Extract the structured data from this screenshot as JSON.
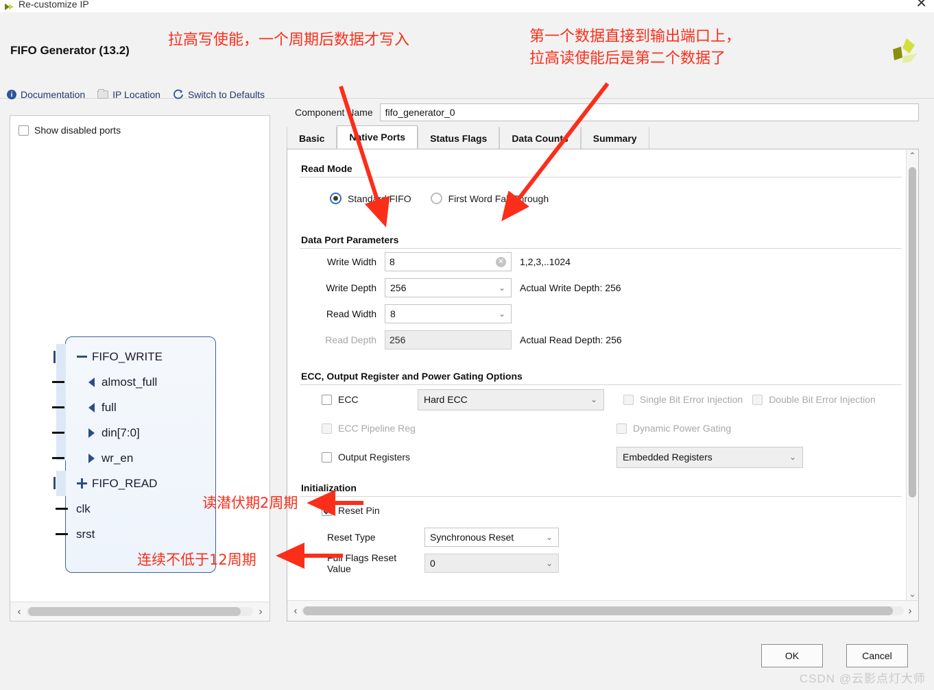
{
  "window": {
    "title": "Re-customize IP",
    "close_label": "✕",
    "app_icon": "xilinx-arrow-icon"
  },
  "header": {
    "ip_title": "FIFO Generator (13.2)",
    "logo": "amd-xilinx-logo",
    "toolbar": [
      {
        "label": "Documentation",
        "icon": "info-icon"
      },
      {
        "label": "IP Location",
        "icon": "folder-icon"
      },
      {
        "label": "Switch to Defaults",
        "icon": "refresh-icon"
      }
    ]
  },
  "left_panel": {
    "show_disabled_ports": {
      "label": "Show disabled ports",
      "checked": false
    },
    "diagram": {
      "ports": [
        {
          "label": "FIFO_WRITE",
          "glyph": "minus",
          "kind": "bus-group",
          "stub": "bus"
        },
        {
          "label": "almost_full",
          "glyph": "tri-left",
          "kind": "output",
          "stub": "pin"
        },
        {
          "label": "full",
          "glyph": "tri-left",
          "kind": "output",
          "stub": "pin"
        },
        {
          "label": "din[7:0]",
          "glyph": "tri-right",
          "kind": "input",
          "stub": "pin"
        },
        {
          "label": "wr_en",
          "glyph": "tri-right",
          "kind": "input",
          "stub": "pin"
        },
        {
          "label": "FIFO_READ",
          "glyph": "plus",
          "kind": "bus-group",
          "stub": "bus"
        },
        {
          "label": "clk",
          "glyph": "none",
          "kind": "input",
          "stub": "pin"
        },
        {
          "label": "srst",
          "glyph": "none",
          "kind": "input",
          "stub": "pin"
        }
      ]
    },
    "scroll": {
      "left_arrow": "‹",
      "right_arrow": "›"
    }
  },
  "right_panel": {
    "component_name": {
      "label": "Component Name",
      "value": "fifo_generator_0"
    },
    "tabs": [
      {
        "label": "Basic",
        "active": false
      },
      {
        "label": "Native Ports",
        "active": true
      },
      {
        "label": "Status Flags",
        "active": false
      },
      {
        "label": "Data Counts",
        "active": false
      },
      {
        "label": "Summary",
        "active": false
      }
    ],
    "read_mode": {
      "title": "Read Mode",
      "options": [
        {
          "label": "Standard FIFO",
          "selected": true
        },
        {
          "label": "First Word Fall Through",
          "selected": false
        }
      ]
    },
    "data_port_parameters": {
      "title": "Data Port Parameters",
      "rows": [
        {
          "label": "Write Width",
          "value": "8",
          "control": "text",
          "disabled": false,
          "clear_icon": "clear-icon",
          "hint": "1,2,3,..1024"
        },
        {
          "label": "Write Depth",
          "value": "256",
          "control": "select",
          "disabled": false,
          "hint": "Actual Write Depth: 256"
        },
        {
          "label": "Read Width",
          "value": "8",
          "control": "select",
          "disabled": false,
          "hint": ""
        },
        {
          "label": "Read Depth",
          "value": "256",
          "control": "text",
          "disabled": true,
          "hint": "Actual Read Depth: 256"
        }
      ]
    },
    "ecc_section": {
      "title": "ECC, Output Register and Power Gating Options",
      "ecc": {
        "label": "ECC",
        "checked": false,
        "disabled": false
      },
      "ecc_mode": {
        "value": "Hard ECC",
        "disabled": true
      },
      "single_bit": {
        "label": "Single Bit Error Injection",
        "checked": false,
        "disabled": true
      },
      "double_bit": {
        "label": "Double Bit Error Injection",
        "checked": false,
        "disabled": true
      },
      "ecc_pipeline": {
        "label": "ECC Pipeline Reg",
        "checked": false,
        "disabled": true
      },
      "dynamic_power_gating": {
        "label": "Dynamic Power Gating",
        "checked": false,
        "disabled": true
      },
      "output_registers": {
        "label": "Output Registers",
        "checked": false,
        "disabled": false
      },
      "embedded_registers": {
        "value": "Embedded Registers",
        "disabled": true
      }
    },
    "initialization": {
      "title": "Initialization",
      "reset_pin": {
        "label": "Reset Pin",
        "checked": true
      },
      "reset_type": {
        "label": "Reset Type",
        "value": "Synchronous Reset"
      },
      "full_flags_reset_value": {
        "label": "Full Flags Reset Value",
        "value": "0"
      }
    },
    "scroll": {
      "up_arrow": "⌃",
      "down_arrow": "⌄",
      "left_arrow": "‹",
      "right_arrow": "›"
    }
  },
  "footer": {
    "ok_label": "OK",
    "cancel_label": "Cancel",
    "watermark": "CSDN @云影点灯大师"
  },
  "annotations": {
    "write_enable": "拉高写使能，一个周期后数据才写入",
    "read_output": "第一个数据直接到输出端口上，\n拉高读使能后是第二个数据了",
    "read_latency": "读潜伏期2周期",
    "reset_cycles": "连续不低于12周期"
  }
}
